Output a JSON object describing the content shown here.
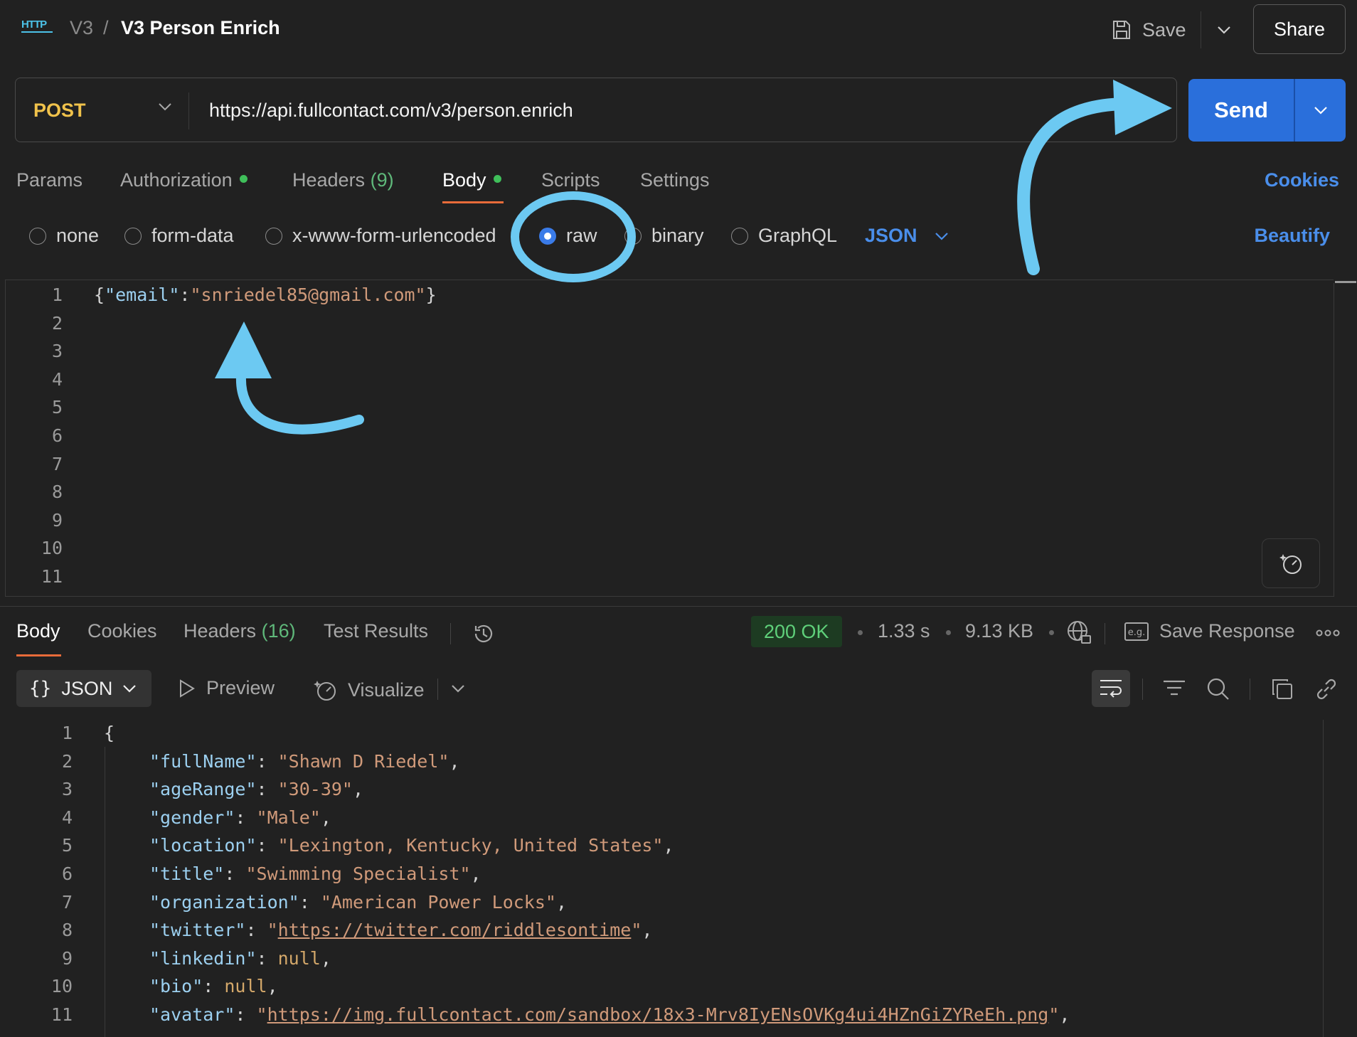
{
  "header": {
    "protocol_icon": "HTTP",
    "breadcrumb_parent": "V3",
    "breadcrumb_sep": "/",
    "title": "V3 Person Enrich",
    "save_label": "Save",
    "share_label": "Share"
  },
  "request": {
    "method": "POST",
    "url": "https://api.fullcontact.com/v3/person.enrich",
    "send_label": "Send",
    "tabs": [
      {
        "label": "Params"
      },
      {
        "label": "Authorization"
      },
      {
        "label": "Headers",
        "count": "(9)"
      },
      {
        "label": "Body"
      },
      {
        "label": "Scripts"
      },
      {
        "label": "Settings"
      }
    ],
    "cookies_label": "Cookies",
    "body_types": [
      "none",
      "form-data",
      "x-www-form-urlencoded",
      "raw",
      "binary",
      "GraphQL"
    ],
    "selected_body_type": "raw",
    "format": "JSON",
    "beautify_label": "Beautify",
    "editor": {
      "line_numbers": [
        "1",
        "2",
        "3",
        "4",
        "5",
        "6",
        "7",
        "8",
        "9",
        "10",
        "11"
      ],
      "line1": {
        "open": "{",
        "key": "\"email\"",
        "colon": ":",
        "value": "\"snriedel85@gmail.com\"",
        "close": "}"
      }
    }
  },
  "response": {
    "tabs": [
      {
        "label": "Body"
      },
      {
        "label": "Cookies"
      },
      {
        "label": "Headers",
        "count": "(16)"
      },
      {
        "label": "Test Results"
      }
    ],
    "status": "200 OK",
    "time": "1.33 s",
    "size": "9.13 KB",
    "save_response_label": "Save Response",
    "view_format": "JSON",
    "preview_label": "Preview",
    "visualize_label": "Visualize",
    "line_numbers": [
      "1",
      "2",
      "3",
      "4",
      "5",
      "6",
      "7",
      "8",
      "9",
      "10",
      "11"
    ],
    "json_open": "{",
    "fields": [
      {
        "key": "\"fullName\"",
        "value": "\"Shawn D Riedel\"",
        "kind": "string"
      },
      {
        "key": "\"ageRange\"",
        "value": "\"30-39\"",
        "kind": "string"
      },
      {
        "key": "\"gender\"",
        "value": "\"Male\"",
        "kind": "string"
      },
      {
        "key": "\"location\"",
        "value": "\"Lexington, Kentucky, United States\"",
        "kind": "string"
      },
      {
        "key": "\"title\"",
        "value": "\"Swimming Specialist\"",
        "kind": "string"
      },
      {
        "key": "\"organization\"",
        "value": "\"American Power Locks\"",
        "kind": "string"
      },
      {
        "key": "\"twitter\"",
        "value": "https://twitter.com/riddlesontime",
        "kind": "url"
      },
      {
        "key": "\"linkedin\"",
        "value": "null",
        "kind": "null"
      },
      {
        "key": "\"bio\"",
        "value": "null",
        "kind": "null"
      },
      {
        "key": "\"avatar\"",
        "value": "https://img.fullcontact.com/sandbox/18x3-Mrv8IyENsOVKg4ui4HZnGiZYReEh.png",
        "kind": "url"
      }
    ]
  },
  "annotation_color": "#6cc9f2"
}
